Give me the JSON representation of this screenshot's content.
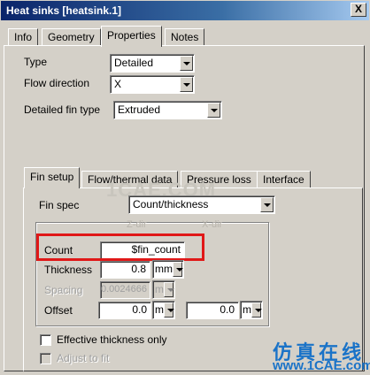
{
  "window": {
    "title": "Heat sinks [heatsink.1]",
    "close_glyph": "X"
  },
  "main_tabs": [
    {
      "label": "Info"
    },
    {
      "label": "Geometry"
    },
    {
      "label": "Properties"
    },
    {
      "label": "Notes"
    }
  ],
  "properties": {
    "type_label": "Type",
    "type_value": "Detailed",
    "flow_direction_label": "Flow direction",
    "flow_direction_value": "X",
    "fin_type_label": "Detailed fin type",
    "fin_type_value": "Extruded"
  },
  "sub_tabs": [
    {
      "label": "Fin setup"
    },
    {
      "label": "Flow/thermal data"
    },
    {
      "label": "Pressure loss"
    },
    {
      "label": "Interface"
    }
  ],
  "fin_setup": {
    "fin_spec_label": "Fin spec",
    "fin_spec_value": "Count/thickness",
    "col_z": "Z-dir",
    "col_x": "X-dir",
    "count_label": "Count",
    "count_value": "$fin_count",
    "thickness_label": "Thickness",
    "thickness_value": "0.8",
    "thickness_unit": "mm",
    "spacing_label": "Spacing",
    "spacing_value": "0.0024666",
    "spacing_unit": "m",
    "offset_label": "Offset",
    "offset_z_value": "0.0",
    "offset_z_unit": "m",
    "offset_x_value": "0.0",
    "offset_x_unit": "m",
    "effective_thickness_label": "Effective thickness only",
    "adjust_to_fit_label": "Adjust to fit"
  },
  "watermark": {
    "text": "1CAE.COM"
  },
  "logo": {
    "chinese": "仿真在线",
    "url": "www.1CAE.com"
  },
  "colors": {
    "title_bar": "#0a246a",
    "highlight": "#e01818",
    "logo": "#1a73c8"
  }
}
